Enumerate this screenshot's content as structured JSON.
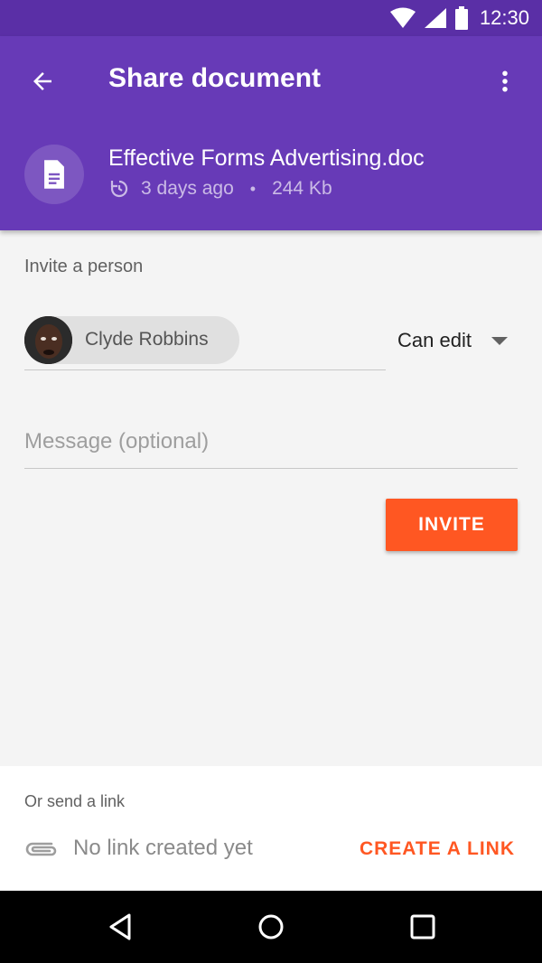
{
  "status_bar": {
    "time": "12:30",
    "icons": [
      "wifi-icon",
      "signal-icon",
      "battery-icon"
    ]
  },
  "app_bar": {
    "title": "Share document",
    "back_icon": "arrow-back-icon",
    "more_icon": "more-vert-icon"
  },
  "document": {
    "name": "Effective Forms Advertising.doc",
    "modified": "3 days ago",
    "separator": "•",
    "size": "244 Kb",
    "icon": "document-icon",
    "history_icon": "history-icon"
  },
  "invite": {
    "section_label": "Invite a person",
    "recipient": "Clyde Robbins",
    "permission": "Can edit",
    "message_placeholder": "Message (optional)",
    "invite_label": "INVITE"
  },
  "link": {
    "section_label": "Or send a link",
    "status": "No link created yet",
    "create_label": "CREATE A LINK",
    "icon": "attachment-icon"
  },
  "colors": {
    "status_bar": "#5a2fa6",
    "app_bar": "#673ab7",
    "accent": "#ff5722"
  },
  "nav": [
    "back-icon",
    "home-icon",
    "recents-icon"
  ]
}
